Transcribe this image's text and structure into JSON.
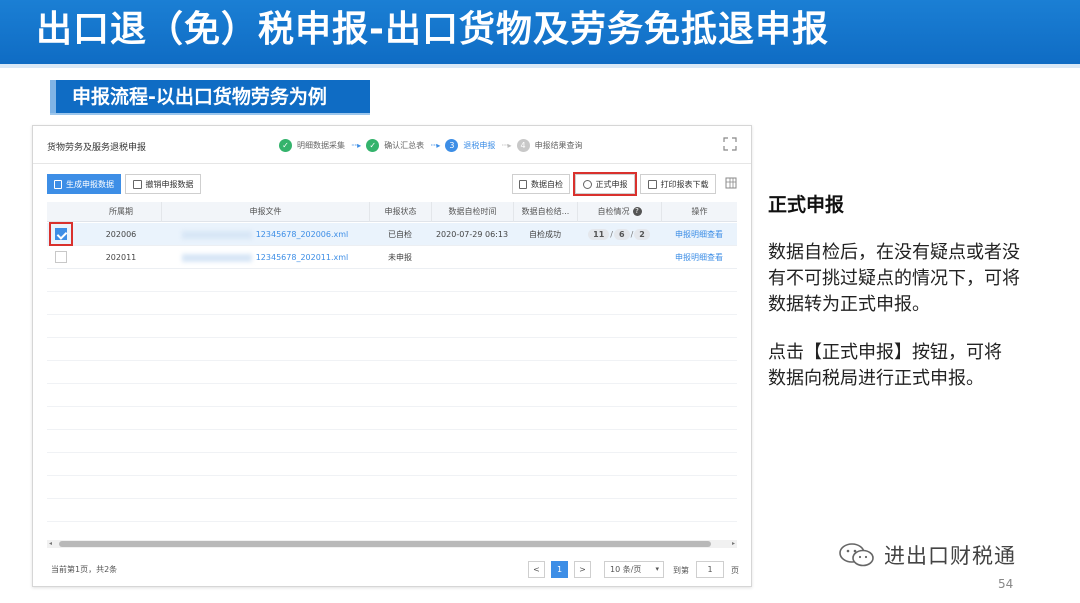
{
  "slide": {
    "title": "出口退（免）税申报-出口货物及劳务免抵退申报",
    "subtitle": "申报流程-以出口货物劳务为例",
    "page_number": "54"
  },
  "app": {
    "title": "货物劳务及服务退税申报",
    "steps": [
      {
        "label": "明细数据采集",
        "state": "done",
        "mark": "✓"
      },
      {
        "label": "确认汇总表",
        "state": "done",
        "mark": "✓"
      },
      {
        "label": "退税申报",
        "state": "current",
        "mark": "3"
      },
      {
        "label": "申报结果查询",
        "state": "todo",
        "mark": "4"
      }
    ],
    "step_arrow": "····▸",
    "toolbar": {
      "generate": "生成申报数据",
      "revoke": "撤销申报数据",
      "self_check": "数据自检",
      "formal": "正式申报",
      "print": "打印报表下载"
    },
    "table": {
      "columns": [
        "所属期",
        "申报文件",
        "申报状态",
        "数据自检时间",
        "数据自检结...",
        "自检情况",
        "操作"
      ],
      "rows": [
        {
          "period": "202006",
          "file": "12345678_202006.xml",
          "status": "已自检",
          "check_time": "2020-07-29 06:13",
          "check_result": "自检成功",
          "pills": [
            "11",
            "6",
            "2"
          ],
          "action": "申报明细查看",
          "checked": true
        },
        {
          "period": "202011",
          "file": "12345678_202011.xml",
          "status": "未申报",
          "check_time": "",
          "check_result": "",
          "pills": [],
          "action": "申报明细查看",
          "checked": false
        }
      ]
    },
    "footer": {
      "total": "当前第1页，共2条",
      "prev": "<",
      "current_page": "1",
      "next": ">",
      "page_size": "10 条/页",
      "goto_label": "到第",
      "goto_value": "1",
      "page_unit": "页"
    }
  },
  "side": {
    "heading": "正式申报",
    "para1": [
      "数据自检后，在没有疑点或者没",
      "有不可挑过疑点的情况下，可将",
      "数据转为正式申报。"
    ],
    "para2": [
      "点击【正式申报】按钮，可将",
      "数据向税局进行正式申报。"
    ]
  },
  "watermark": {
    "text": "进出口财税通"
  },
  "colors": {
    "brand_blue": "#0f6cc4",
    "accent_blue": "#3d8ee6",
    "highlight_red": "#d9312d",
    "success_green": "#34b36c"
  }
}
